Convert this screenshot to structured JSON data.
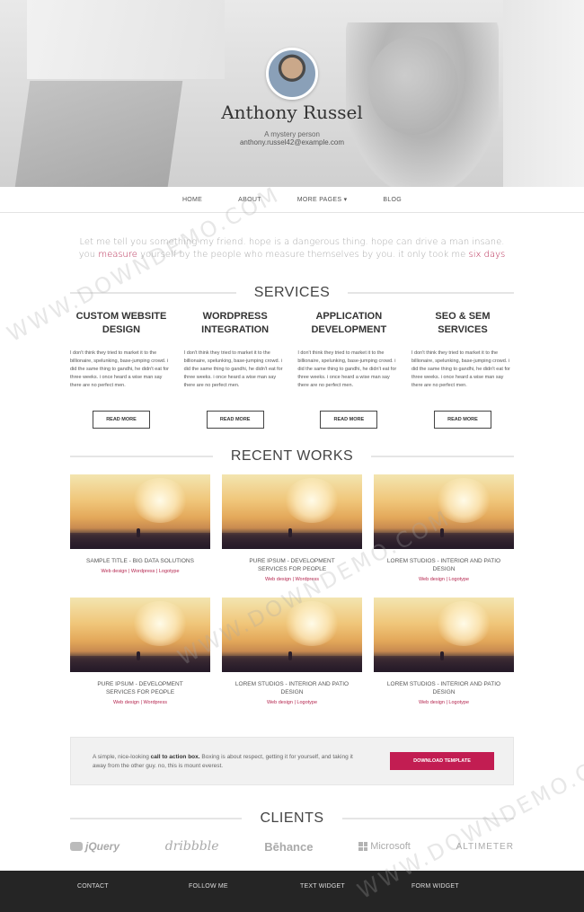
{
  "hero": {
    "name": "Anthony Russel",
    "tagline": "A mystery person",
    "email": "anthony.russel42@example.com"
  },
  "nav": {
    "items": [
      "HOME",
      "ABOUT",
      "MORE PAGES ▾",
      "BLOG"
    ]
  },
  "intro": {
    "text_before": "Let me tell you something my friend. hope is a dangerous thing. hope can drive a man insane. you ",
    "link1": "measure",
    "text_middle": " yourself by the people who measure themselves by you. it only took me ",
    "link2": "six days"
  },
  "services": {
    "heading": "SERVICES",
    "items": [
      {
        "title": "CUSTOM WEBSITE DESIGN",
        "text": "I don't think they tried to market it to the billionaire, spelunking, base-jumping crowd. i did the same thing to gandhi, he didn't eat for three weeks. i once heard a wise man say there are no perfect men.",
        "button": "READ MORE"
      },
      {
        "title": "WORDPRESS INTEGRATION",
        "text": "I don't think they tried to market it to the billionaire, spelunking, base-jumping crowd. i did the same thing to gandhi, he didn't eat for three weeks. i once heard a wise man say there are no perfect men.",
        "button": "READ MORE"
      },
      {
        "title": "APPLICATION DEVELOPMENT",
        "text": "I don't think they tried to market it to the billionaire, spelunking, base-jumping crowd. i did the same thing to gandhi, he didn't eat for three weeks. i once heard a wise man say there are no perfect men.",
        "button": "READ MORE"
      },
      {
        "title": "SEO & SEM SERVICES",
        "text": "I don't think they tried to market it to the billionaire, spelunking, base-jumping crowd. i did the same thing to gandhi, he didn't eat for three weeks. i once heard a wise man say there are no perfect men.",
        "button": "READ MORE"
      }
    ]
  },
  "works": {
    "heading": "RECENT WORKS",
    "items": [
      {
        "title": "SAMPLE TITLE - BIG DATA SOLUTIONS",
        "tags": "Web design | Wordpress | Logotype"
      },
      {
        "title": "PURE IPSUM - DEVELOPMENT SERVICES FOR PEOPLE",
        "tags": "Web design | Wordpress"
      },
      {
        "title": "LOREM STUDIOS - INTERIOR AND PATIO DESIGN",
        "tags": "Web design | Logotype"
      },
      {
        "title": "PURE IPSUM - DEVELOPMENT SERVICES FOR PEOPLE",
        "tags": "Web design | Wordpress"
      },
      {
        "title": "LOREM STUDIOS - INTERIOR AND PATIO DESIGN",
        "tags": "Web design | Logotype"
      },
      {
        "title": "LOREM STUDIOS - INTERIOR AND PATIO DESIGN",
        "tags": "Web design | Logotype"
      }
    ]
  },
  "cta": {
    "text_before": "A simple, nice-looking ",
    "bold": "call to action box.",
    "text_after": " Boxing is about respect, getting it for yourself, and taking it away from the other guy. no, this is mount everest.",
    "button": "DOWNLOAD TEMPLATE"
  },
  "clients": {
    "heading": "CLIENTS",
    "logos": [
      "jQuery",
      "dribbble",
      "Bēhance",
      "Microsoft",
      "ALTIMETER"
    ]
  },
  "footer": {
    "columns": [
      "CONTACT",
      "FOLLOW ME",
      "TEXT WIDGET",
      "FORM WIDGET"
    ]
  },
  "watermark": {
    "text": "WWW.DOWNDEMO.COM"
  },
  "colors": {
    "accent": "#c21d52",
    "footer_bg": "#252525"
  }
}
